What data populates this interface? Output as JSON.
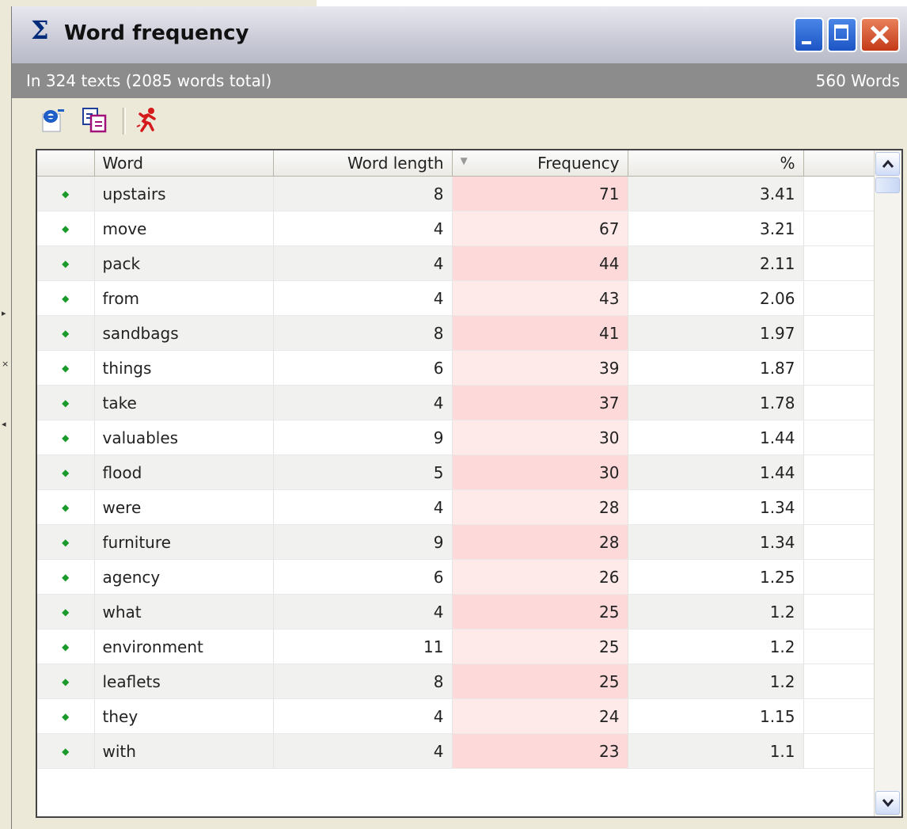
{
  "window": {
    "title": "Word frequency",
    "title_icon": "sigma-icon"
  },
  "info": {
    "left": "In 324 texts  (2085 words total)",
    "right": "560 Words"
  },
  "toolbar": {
    "icons": [
      "ie-export-icon",
      "copy-icon",
      "run-icon"
    ]
  },
  "table": {
    "columns": [
      "",
      "Word",
      "Word length",
      "Frequency",
      "%"
    ],
    "sort_column": "Frequency",
    "sort_direction": "descending",
    "rows": [
      {
        "word": "upstairs",
        "length": "8",
        "frequency": "71",
        "percent": "3.41"
      },
      {
        "word": "move",
        "length": "4",
        "frequency": "67",
        "percent": "3.21"
      },
      {
        "word": "pack",
        "length": "4",
        "frequency": "44",
        "percent": "2.11"
      },
      {
        "word": "from",
        "length": "4",
        "frequency": "43",
        "percent": "2.06"
      },
      {
        "word": "sandbags",
        "length": "8",
        "frequency": "41",
        "percent": "1.97"
      },
      {
        "word": "things",
        "length": "6",
        "frequency": "39",
        "percent": "1.87"
      },
      {
        "word": "take",
        "length": "4",
        "frequency": "37",
        "percent": "1.78"
      },
      {
        "word": "valuables",
        "length": "9",
        "frequency": "30",
        "percent": "1.44"
      },
      {
        "word": "flood",
        "length": "5",
        "frequency": "30",
        "percent": "1.44"
      },
      {
        "word": "were",
        "length": "4",
        "frequency": "28",
        "percent": "1.34"
      },
      {
        "word": "furniture",
        "length": "9",
        "frequency": "28",
        "percent": "1.34"
      },
      {
        "word": "agency",
        "length": "6",
        "frequency": "26",
        "percent": "1.25"
      },
      {
        "word": "what",
        "length": "4",
        "frequency": "25",
        "percent": "1.2"
      },
      {
        "word": "environment",
        "length": "11",
        "frequency": "25",
        "percent": "1.2"
      },
      {
        "word": "leaflets",
        "length": "8",
        "frequency": "25",
        "percent": "1.2"
      },
      {
        "word": "they",
        "length": "4",
        "frequency": "24",
        "percent": "1.15"
      },
      {
        "word": "with",
        "length": "4",
        "frequency": "23",
        "percent": "1.1"
      }
    ]
  },
  "colors": {
    "frequency_highlight": "#fdd9d9",
    "bullet": "#1a9a2a",
    "info_bar": "#8c8c8c"
  }
}
